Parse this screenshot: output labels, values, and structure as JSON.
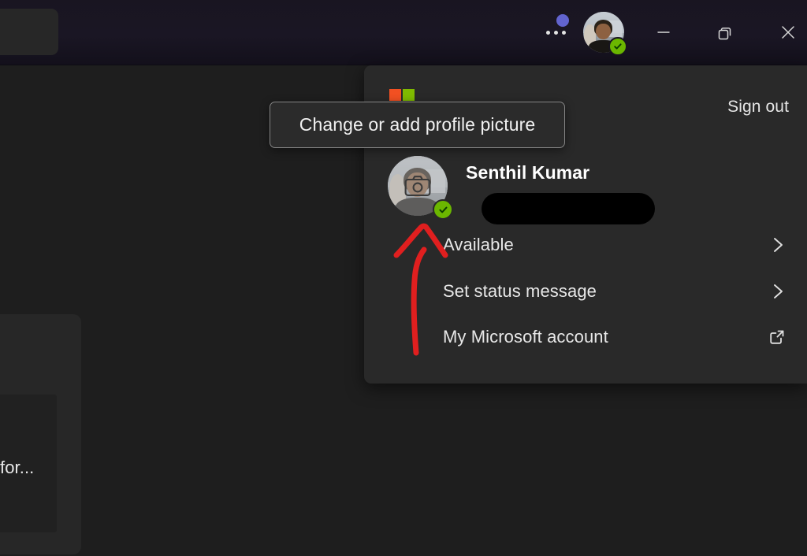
{
  "titlebar": {
    "more_button": "more-options",
    "badge_color": "#6264cf",
    "window_controls": {
      "minimize": "minimize",
      "maximize": "restore",
      "close": "close"
    },
    "avatar_alt": "Senthil Kumar",
    "presence": "Available"
  },
  "tooltip": {
    "text": "Change or add profile picture"
  },
  "profile_panel": {
    "sign_out": "Sign out",
    "logo": "microsoft-logo",
    "user": {
      "name": "Senthil Kumar",
      "email_redacted": "",
      "presence": "Available",
      "avatar_action": "Change or add profile picture"
    },
    "menu": [
      {
        "label": "Available",
        "trailing_icon": "chevron-right-icon"
      },
      {
        "label": "Set status message",
        "trailing_icon": "chevron-right-icon"
      },
      {
        "label": "My Microsoft account",
        "trailing_icon": "open-in-new-icon"
      }
    ]
  },
  "background": {
    "card_text": "for..."
  },
  "annotation": {
    "arrow_color": "#e01f1f",
    "points_to": "profile-avatar-camera"
  }
}
